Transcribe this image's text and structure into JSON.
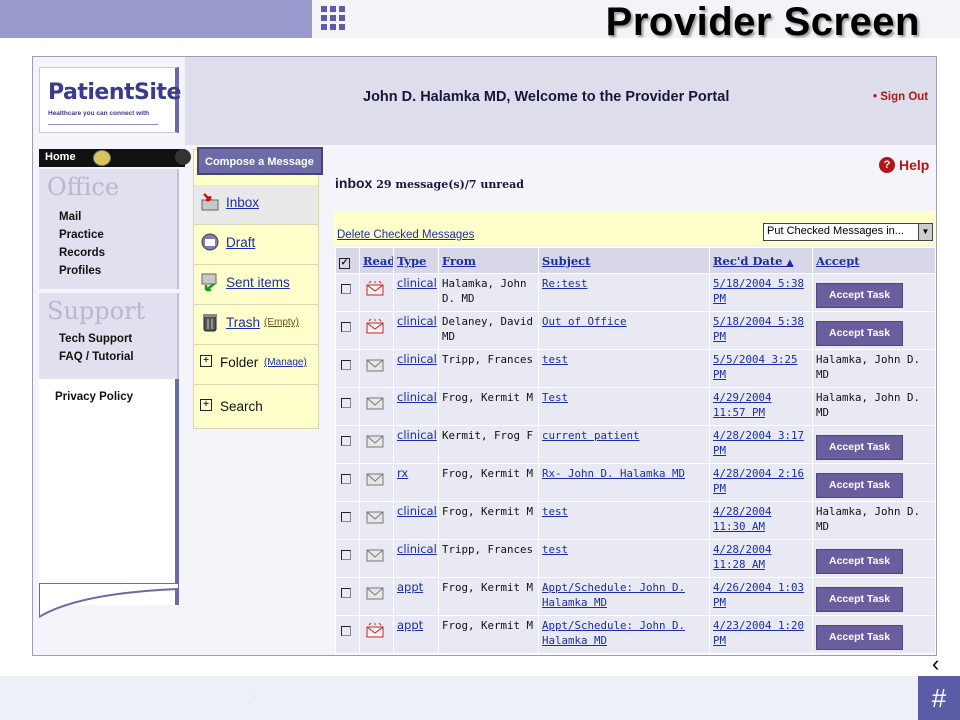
{
  "slide": {
    "title": "Provider Screen",
    "page_number": "#",
    "back_arrow": "‹",
    "footer_dots": "::"
  },
  "portal": {
    "logo_text": "PatientSite",
    "logo_tagline": "Healthcare you can connect with",
    "welcome": "John D. Halamka MD, Welcome to the Provider Portal",
    "signout": "• Sign Out",
    "help": "Help"
  },
  "leftnav": {
    "home": "Home",
    "office_head": "Office",
    "office_items": [
      "Mail",
      "Practice",
      "Records",
      "Profiles"
    ],
    "support_head": "Support",
    "support_items": [
      "Tech Support",
      "FAQ / Tutorial"
    ],
    "privacy": "Privacy Policy"
  },
  "folders": {
    "compose": "Compose a Message",
    "items": [
      {
        "label": "Inbox",
        "sub": ""
      },
      {
        "label": "Draft",
        "sub": ""
      },
      {
        "label": "Sent items",
        "sub": ""
      },
      {
        "label": "Trash",
        "sub": "(Empty)"
      },
      {
        "label": "Folder",
        "sub": "(Manage)"
      },
      {
        "label": "Search",
        "sub": ""
      }
    ]
  },
  "inbox": {
    "title": "inbox",
    "count": "29 message(s)/7 unread",
    "delete_link": "Delete Checked Messages",
    "move_select": "Put Checked Messages in...",
    "columns": [
      "Read",
      "Type",
      "From",
      "Subject",
      "Rec'd Date",
      "Accept"
    ],
    "accept_label": "Accept Task",
    "rows": [
      {
        "read": "urgent",
        "type": "clinical",
        "from": "Halamka, John D. MD",
        "subject": "Re:test",
        "date": "5/18/2004 5:38 PM",
        "accept": ""
      },
      {
        "read": "urgent",
        "type": "clinical",
        "from": "Delaney, David MD",
        "subject": "Out of Office",
        "date": "5/18/2004 5:38 PM",
        "accept": ""
      },
      {
        "read": "read",
        "type": "clinical",
        "from": "Tripp, Frances",
        "subject": "test",
        "date": "5/5/2004 3:25 PM",
        "accept": "Halamka, John D. MD"
      },
      {
        "read": "read",
        "type": "clinical",
        "from": "Frog, Kermit M",
        "subject": "Test",
        "date": "4/29/2004 11:57 PM",
        "accept": "Halamka, John D. MD"
      },
      {
        "read": "read",
        "type": "clinical",
        "from": "Kermit, Frog F",
        "subject": "current patient",
        "date": "4/28/2004 3:17 PM",
        "accept": ""
      },
      {
        "read": "read",
        "type": "rx",
        "from": "Frog, Kermit M",
        "subject": "Rx- John D. Halamka MD",
        "date": "4/28/2004 2:16 PM",
        "accept": ""
      },
      {
        "read": "read",
        "type": "clinical",
        "from": "Frog, Kermit M",
        "subject": "test",
        "date": "4/28/2004 11:30 AM",
        "accept": "Halamka, John D. MD"
      },
      {
        "read": "read",
        "type": "clinical",
        "from": "Tripp, Frances",
        "subject": "test",
        "date": "4/28/2004 11:28 AM",
        "accept": ""
      },
      {
        "read": "read",
        "type": "appt",
        "from": "Frog, Kermit M",
        "subject": "Appt/Schedule: John D. Halamka MD",
        "date": "4/26/2004 1:03 PM",
        "accept": ""
      },
      {
        "read": "urgent",
        "type": "appt",
        "from": "Frog, Kermit M",
        "subject": "Appt/Schedule: John D. Halamka MD",
        "date": "4/23/2004 1:20 PM",
        "accept": ""
      }
    ]
  },
  "colors": {
    "accent": "#5b5ba6",
    "accept_button": "#6b5e9e",
    "link": "#1b2ea3",
    "signout": "#b01818"
  }
}
